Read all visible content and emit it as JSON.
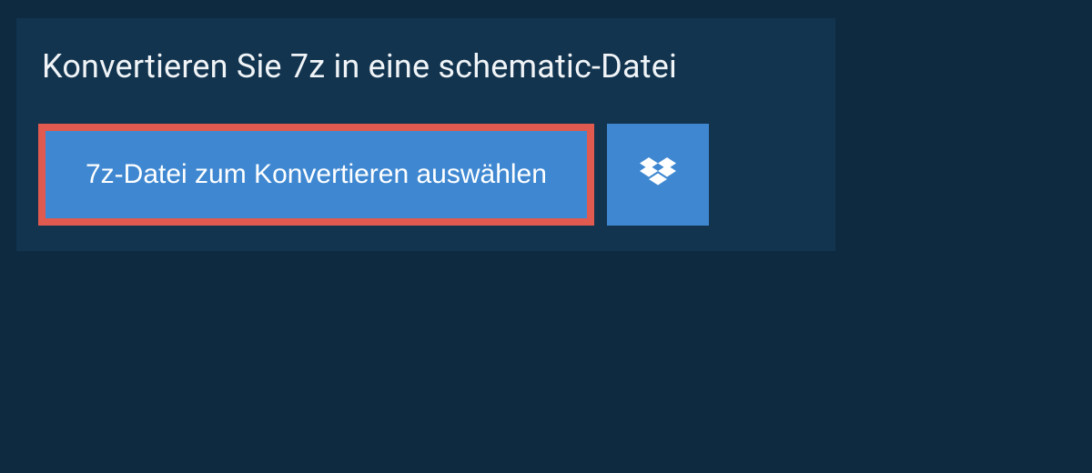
{
  "header": {
    "title": "Konvertieren Sie 7z in eine schematic-Datei"
  },
  "actions": {
    "select_file_label": "7z-Datei zum Konvertieren auswählen",
    "dropbox_icon": "dropbox"
  },
  "colors": {
    "page_bg": "#0e2a41",
    "panel_bg": "#12344f",
    "button_bg": "#3f88d1",
    "highlight_border": "#e05a4f",
    "text_light": "#f0f4f7",
    "button_text": "#ffffff"
  }
}
